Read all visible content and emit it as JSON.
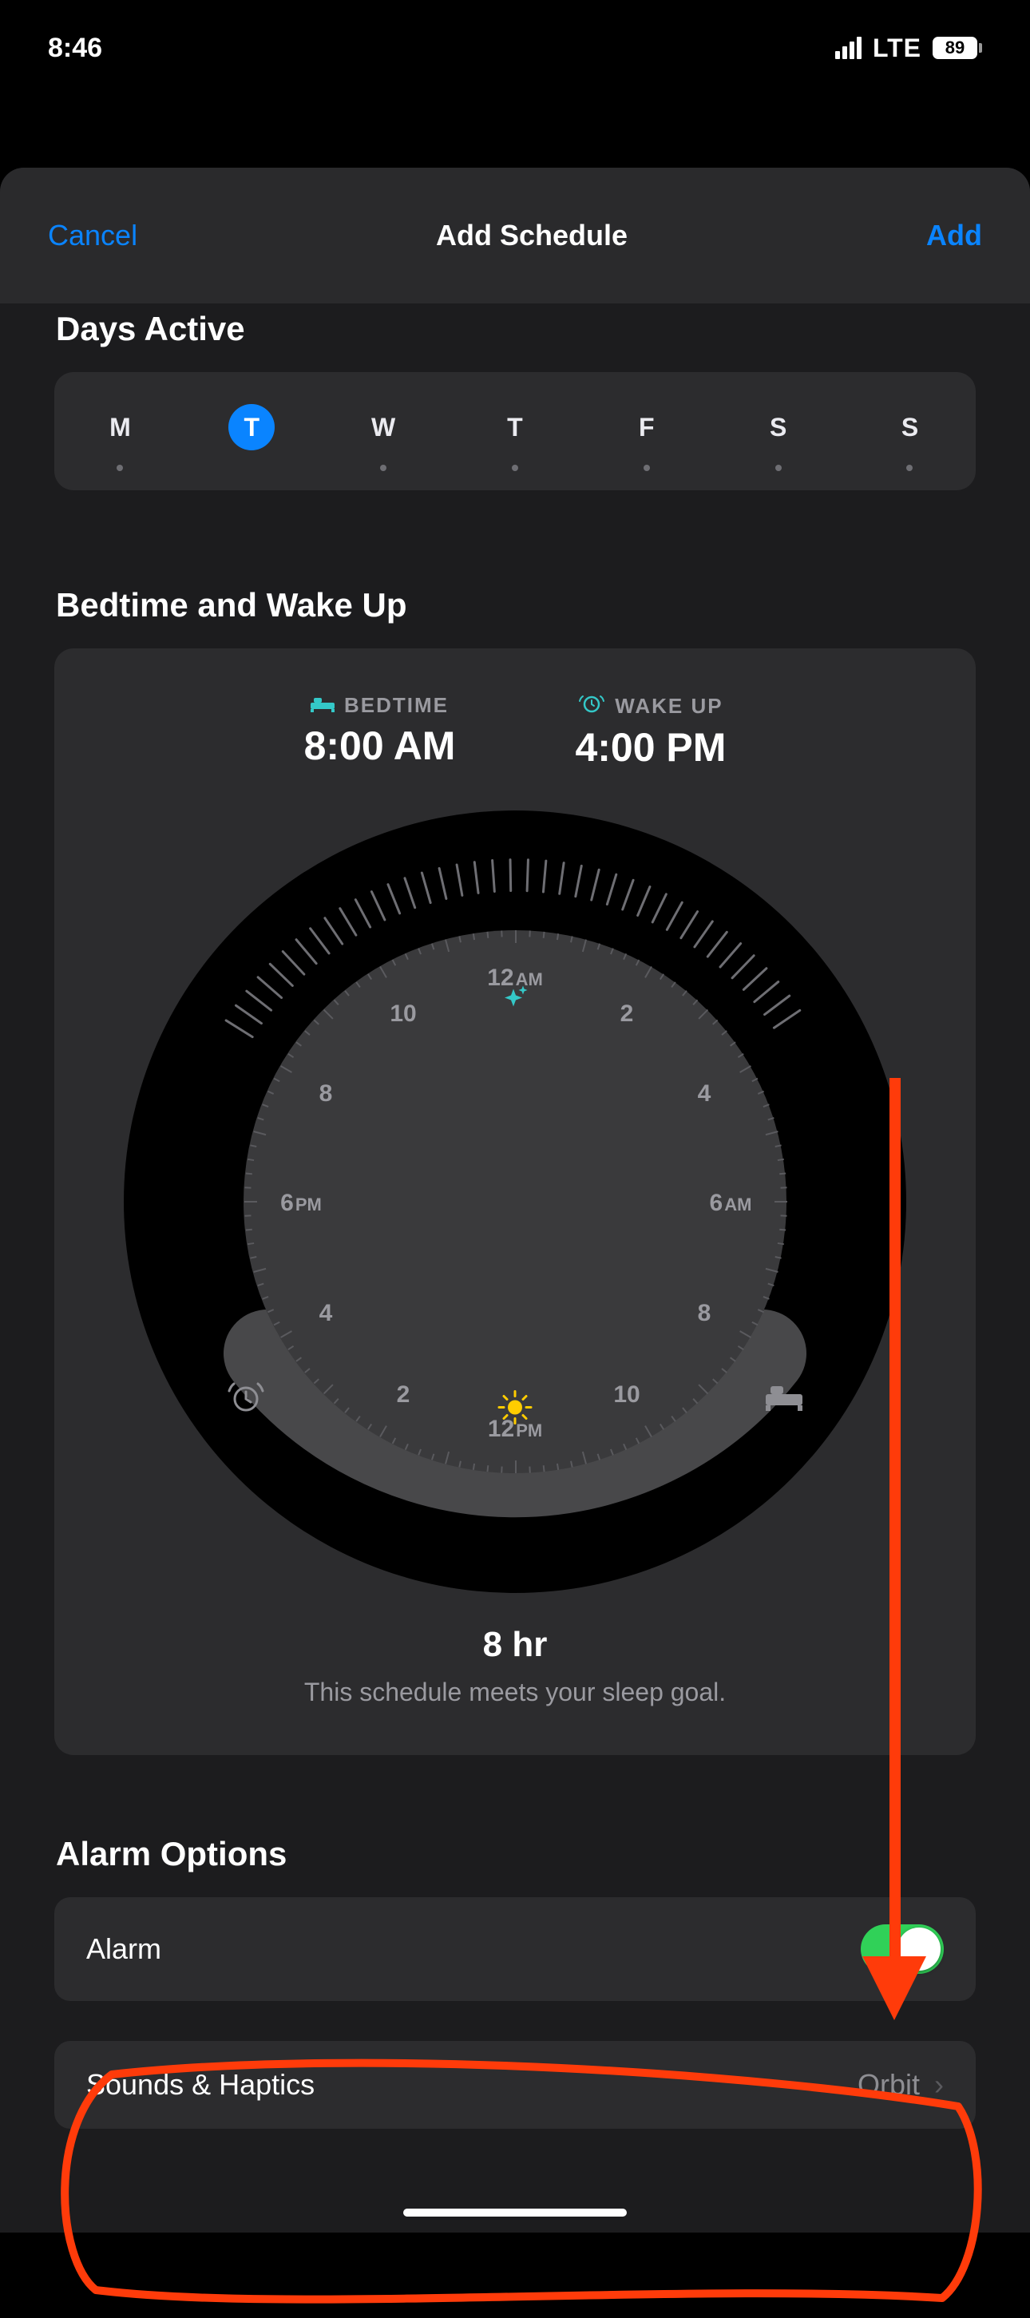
{
  "status": {
    "time": "8:46",
    "network": "LTE",
    "battery": "89"
  },
  "nav": {
    "cancel": "Cancel",
    "title": "Add Schedule",
    "add": "Add"
  },
  "days": {
    "title": "Days Active",
    "items": [
      {
        "label": "M",
        "selected": false
      },
      {
        "label": "T",
        "selected": true
      },
      {
        "label": "W",
        "selected": false
      },
      {
        "label": "T",
        "selected": false
      },
      {
        "label": "F",
        "selected": false
      },
      {
        "label": "S",
        "selected": false
      },
      {
        "label": "S",
        "selected": false
      }
    ]
  },
  "bedtime": {
    "title": "Bedtime and Wake Up",
    "bed_label": "BEDTIME",
    "bed_time": "8:00 AM",
    "wake_label": "WAKE UP",
    "wake_time": "4:00 PM",
    "duration": "8 hr",
    "goal_text": "This schedule meets your sleep goal."
  },
  "clock": {
    "l12am": "12",
    "am": "AM",
    "l2": "2",
    "l4": "4",
    "l6am": "6",
    "l8": "8",
    "l10r": "10",
    "l12pm": "12",
    "pm": "PM",
    "l2b": "2",
    "l4b": "4",
    "l6pm": "6",
    "l8b": "8",
    "l10l": "10"
  },
  "alarm": {
    "title": "Alarm Options",
    "row_label": "Alarm",
    "sounds_label": "Sounds & Haptics",
    "sounds_value": "Orbit"
  },
  "colors": {
    "accent": "#0a84ff",
    "teal": "#34c8c8",
    "green": "#30d158",
    "annot": "#ff3b0a"
  }
}
